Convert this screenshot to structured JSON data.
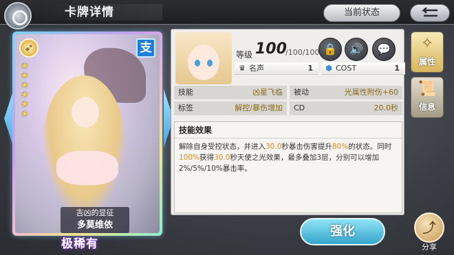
{
  "header": {
    "title": "卡牌详情",
    "state_button": "当前状态"
  },
  "card": {
    "type_badge": "支",
    "stars": 6,
    "subtitle": "吉凶的显征",
    "name": "多莫维依",
    "rarity": "极稀有",
    "weapon_icon": "bow-icon"
  },
  "info": {
    "level_label": "等级",
    "level": "100",
    "level_max": "/100/100",
    "fame_label": "名声",
    "fame_value": "1",
    "cost_label": "COST",
    "cost_value": "1",
    "icons": [
      "lock-icon",
      "sound-icon",
      "chat-icon"
    ]
  },
  "attributes": [
    [
      {
        "label": "技能",
        "value": "凶星飞临"
      },
      {
        "label": "被动",
        "value": "光属性附伤+60"
      }
    ],
    [
      {
        "label": "标签",
        "value": "解控/暴伤增加"
      },
      {
        "label": "CD",
        "value": "20.0秒"
      }
    ]
  ],
  "skill": {
    "title": "技能效果",
    "desc_1": "解除自身受控状态，并进入",
    "desc_hl1": "30.0",
    "desc_2": "秒暴击伤害提升",
    "desc_hl2": "80%",
    "desc_3": "的状态。同时",
    "desc_hl3": "100%",
    "desc_4": "获得",
    "desc_hl4": "30.0",
    "desc_5": "秒天使之光效果，最多叠加3层，分别可以增加2%/5%/10%暴击率。"
  },
  "side_tabs": [
    {
      "label": "属性",
      "icon": "attribute-icon",
      "active": true
    },
    {
      "label": "信息",
      "icon": "info-scroll-icon",
      "active": false
    }
  ],
  "actions": {
    "enhance": "强化",
    "share": "分享"
  }
}
